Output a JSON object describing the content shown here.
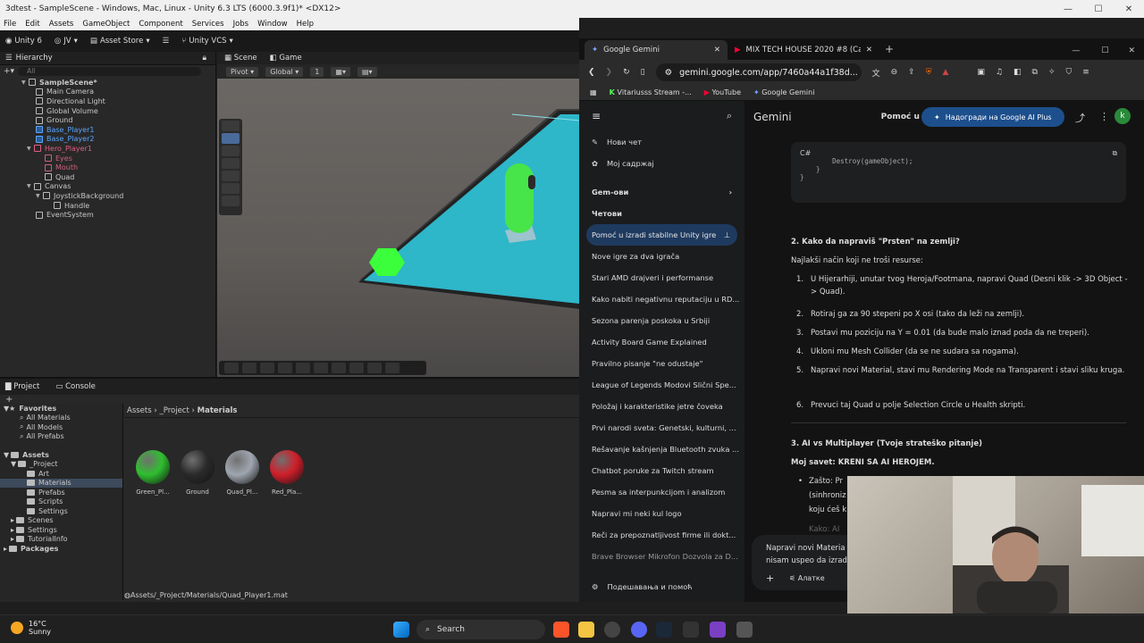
{
  "window": {
    "title": "3dtest - SampleScene - Windows, Mac, Linux - Unity 6.3 LTS (6000.3.9f1)* <DX12>"
  },
  "menu": [
    "File",
    "Edit",
    "Assets",
    "GameObject",
    "Component",
    "Services",
    "Jobs",
    "Window",
    "Help"
  ],
  "unity_toolbar": {
    "unity": "Unity 6",
    "account": "JV",
    "store": "Asset Store",
    "vcs": "Unity VCS"
  },
  "hierarchy": {
    "tab": "Hierarchy",
    "search_placeholder": "All",
    "items": [
      "SampleScene*",
      "Main Camera",
      "Directional Light",
      "Global Volume",
      "Ground",
      "Base_Player1",
      "Base_Player2",
      "Hero_Player1",
      "Eyes",
      "Mouth",
      "Quad",
      "Canvas",
      "JoystickBackground",
      "Handle",
      "EventSystem"
    ]
  },
  "scene": {
    "tabs": [
      "Scene",
      "Game"
    ],
    "pivot": "Pivot",
    "global": "Global",
    "snap": "1"
  },
  "project": {
    "tabs": [
      "Project",
      "Console"
    ],
    "tree": [
      "Favorites",
      "All Materials",
      "All Models",
      "All Prefabs",
      "Assets",
      "_Project",
      "Art",
      "Materials",
      "Prefabs",
      "Scripts",
      "Settings",
      "Scenes",
      "Settings",
      "TutorialInfo",
      "Packages"
    ],
    "breadcrumb": [
      "Assets",
      "_Project",
      "Materials"
    ],
    "materials": [
      {
        "name": "Green_Pl...",
        "color": "#2fbf2f"
      },
      {
        "name": "Ground",
        "color": "#2a2a2a"
      },
      {
        "name": "Quad_Pl...",
        "color": "#9fa6b0"
      },
      {
        "name": "Red_Pla...",
        "color": "#d01e2a"
      }
    ],
    "status_path": "Assets/_Project/Materials/Quad_Player1.mat"
  },
  "browser": {
    "tabs": [
      "Google Gemini",
      "MIX TECH HOUSE 2020 #8 (Cam..."
    ],
    "url": "gemini.google.com/app/7460a44a1f38d...",
    "bookmarks": [
      "Vitariusss Stream -...",
      "YouTube",
      "Google Gemini"
    ]
  },
  "gemini": {
    "brand": "Gemini",
    "conv_title": "Pomoć u izr",
    "upgrade": "Надогради на Google AI Plus",
    "avatar": "k",
    "new_chat": "Нови чет",
    "my_content": "Мој садржај",
    "gems": "Gem-ови",
    "chats_label": "Четови",
    "chats": [
      "Pomoć u izradi stabilne Unity igre",
      "Nove igre za dva igrača",
      "Stari AMD drajveri i performanse",
      "Kako nabiti negativnu reputaciju u RD...",
      "Sezona parenja poskoka u Srbiji",
      "Activity Board Game Explained",
      "Pravilno pisanje \"ne odustaje\"",
      "League of Legends Modovi Slični Spe...",
      "Položaj i karakteristike jetre čoveka",
      "Prvi narodi sveta: Genetski, kulturni, ...",
      "Rešavanje kašnjenja Bluetooth zvuka ...",
      "Chatbot poruke za Twitch stream",
      "Pesma sa interpunkcijom i analizom",
      "Napravi mi neki kul logo",
      "Reči za prepoznatljivost firme ili dokt...",
      "Brave Browser Mikrofon Dozvola za D..."
    ],
    "settings": "Подешавања и помоћ",
    "code_lang": "C#",
    "code": "        Destroy(gameObject);\n    }\n}",
    "h2": "2. Kako da napraviš \"Prsten\" na zemlji?",
    "intro": "Najlakši način koji ne troši resurse:",
    "steps": [
      "U Hijerarhiji, unutar tvog Heroja/Footmana, napravi Quad (Desni klik -> 3D Object -> Quad).",
      "Rotiraj ga za 90 stepeni po X osi (tako da leži na zemlji).",
      "Postavi mu poziciju na Y = 0.01 (da bude malo iznad poda da ne treperi).",
      "Ukloni mu Mesh Collider (da se ne sudara sa nogama).",
      "Napravi novi Material, stavi mu Rendering Mode na Transparent i stavi sliku kruga.",
      "Prevuci taj Quad u polje Selection Circle u Health skripti."
    ],
    "h3": "3. AI vs Multiplayer (Tvoje strateško pitanje)",
    "advice": "Moj savet: KRENI SA AI HEROJEM.",
    "bullet": "Zašto: Pr",
    "bullet_l2": "(sinhroniz",
    "bullet_l3": "koju ćeš k",
    "bullet_l4": "Kako: AI",
    "prompt_l1": "Napravi novi Materia",
    "prompt_l2": "nisam uspeo da izradi",
    "tools": "Алатке"
  },
  "taskbar": {
    "weather_temp": "16°C",
    "weather_desc": "Sunny",
    "search": "Search"
  }
}
